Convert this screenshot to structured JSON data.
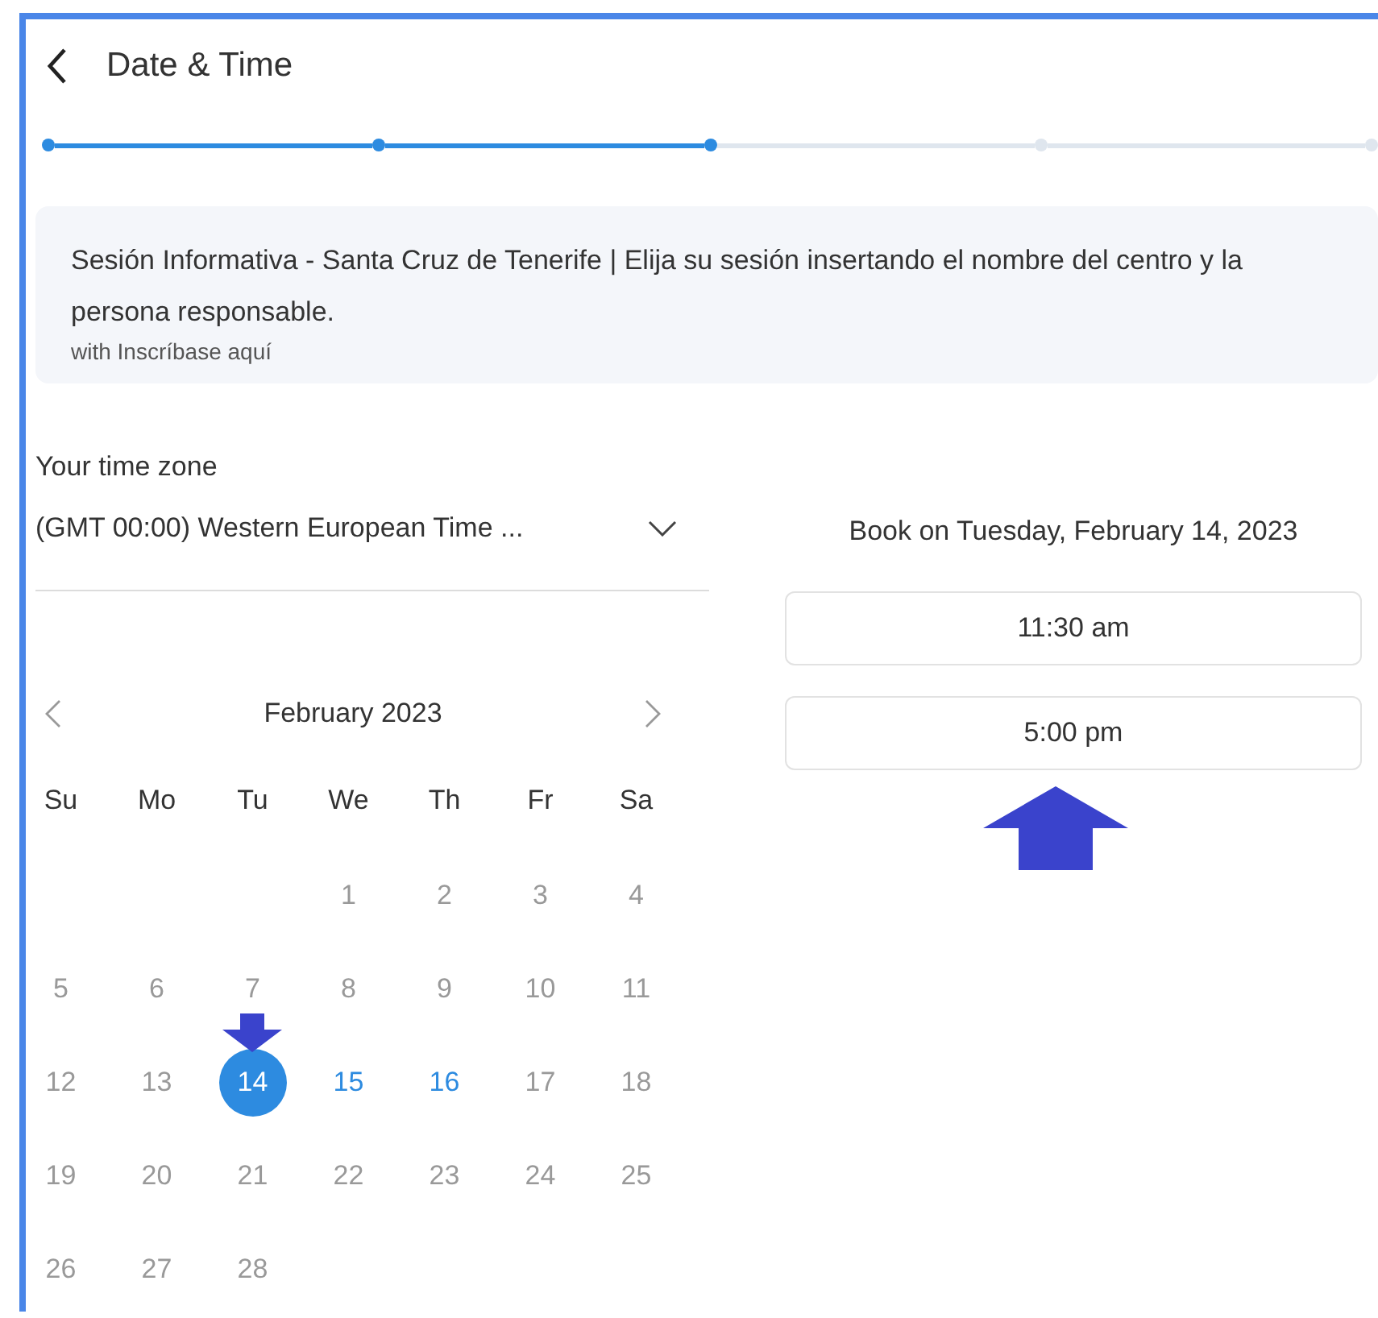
{
  "header": {
    "title": "Date & Time"
  },
  "steps": [
    {
      "done": true
    },
    {
      "done": true
    },
    {
      "done": true
    },
    {
      "done": false
    },
    {
      "done": false
    }
  ],
  "event": {
    "title": "Sesión Informativa - Santa Cruz de Tenerife | Elija su sesión insertando el nombre del centro y la persona responsable.",
    "host": "with Inscríbase aquí"
  },
  "timezone": {
    "label": "Your time zone",
    "value": "(GMT 00:00) Western European Time ..."
  },
  "calendar": {
    "month": "February  2023",
    "weekdays": [
      "Su",
      "Mo",
      "Tu",
      "We",
      "Th",
      "Fr",
      "Sa"
    ],
    "weeks": [
      [
        {
          "label": "1",
          "available": false,
          "selected": false
        },
        {
          "label": "2",
          "available": false,
          "selected": false
        },
        {
          "label": "3",
          "available": false,
          "selected": false
        },
        {
          "label": "4",
          "available": false,
          "selected": false
        }
      ],
      [
        {
          "label": "5",
          "available": false,
          "selected": false
        },
        {
          "label": "6",
          "available": false,
          "selected": false
        },
        {
          "label": "7",
          "available": false,
          "selected": false
        },
        {
          "label": "8",
          "available": false,
          "selected": false
        },
        {
          "label": "9",
          "available": false,
          "selected": false
        },
        {
          "label": "10",
          "available": false,
          "selected": false
        },
        {
          "label": "11",
          "available": false,
          "selected": false
        }
      ],
      [
        {
          "label": "12",
          "available": false,
          "selected": false
        },
        {
          "label": "13",
          "available": false,
          "selected": false
        },
        {
          "label": "14",
          "available": true,
          "selected": true
        },
        {
          "label": "15",
          "available": true,
          "selected": false
        },
        {
          "label": "16",
          "available": true,
          "selected": false
        },
        {
          "label": "17",
          "available": false,
          "selected": false
        },
        {
          "label": "18",
          "available": false,
          "selected": false
        }
      ],
      [
        {
          "label": "19",
          "available": false,
          "selected": false
        },
        {
          "label": "20",
          "available": false,
          "selected": false
        },
        {
          "label": "21",
          "available": false,
          "selected": false
        },
        {
          "label": "22",
          "available": false,
          "selected": false
        },
        {
          "label": "23",
          "available": false,
          "selected": false
        },
        {
          "label": "24",
          "available": false,
          "selected": false
        },
        {
          "label": "25",
          "available": false,
          "selected": false
        }
      ],
      [
        {
          "label": "26",
          "available": false,
          "selected": false
        },
        {
          "label": "27",
          "available": false,
          "selected": false
        },
        {
          "label": "28",
          "available": false,
          "selected": false
        }
      ]
    ]
  },
  "booking": {
    "heading": "Book on Tuesday, February 14, 2023",
    "slots": [
      "11:30 am",
      "5:00 pm"
    ]
  }
}
